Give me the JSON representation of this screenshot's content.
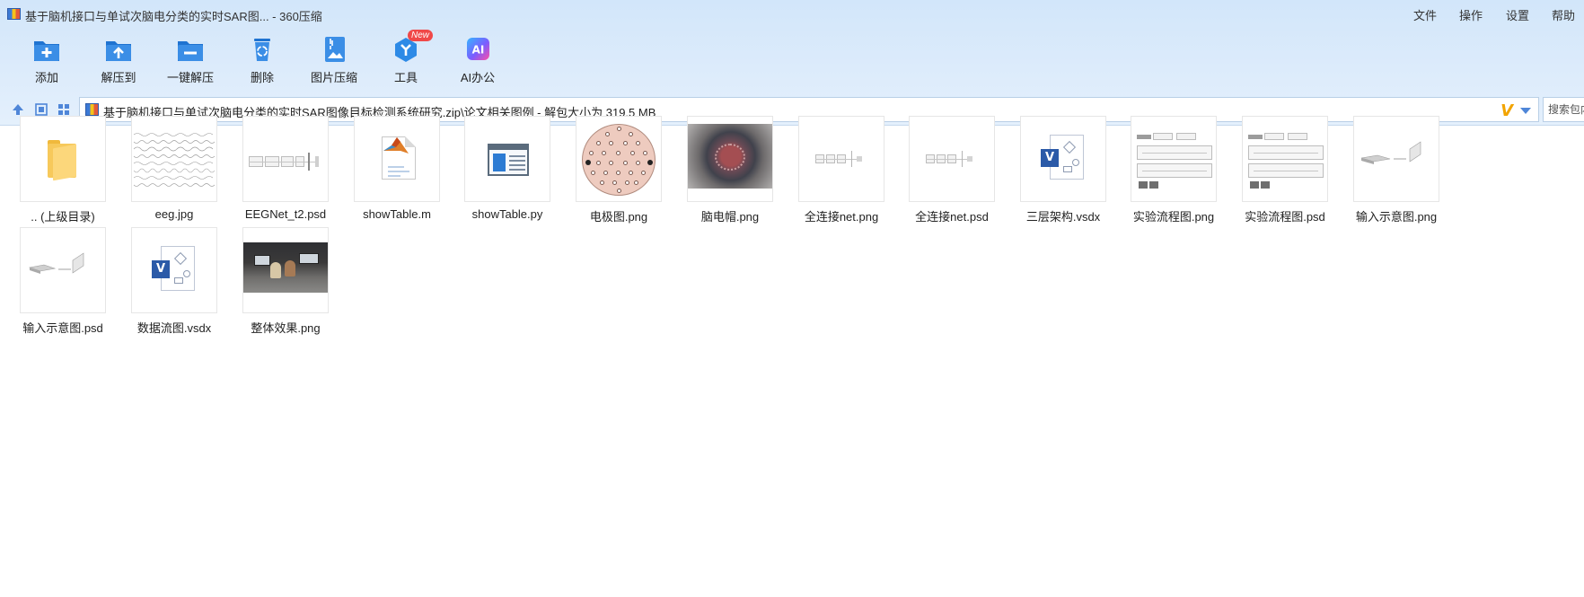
{
  "window": {
    "title": "基于脑机接口与单试次脑电分类的实时SAR图... - 360压缩"
  },
  "menu": {
    "file": "文件",
    "operate": "操作",
    "settings": "设置",
    "help": "帮助"
  },
  "toolbar": {
    "items": [
      {
        "label": "添加",
        "icon": "add-icon"
      },
      {
        "label": "解压到",
        "icon": "extract-to-icon"
      },
      {
        "label": "一键解压",
        "icon": "one-click-extract-icon"
      },
      {
        "label": "删除",
        "icon": "delete-icon"
      },
      {
        "label": "图片压缩",
        "icon": "image-compress-icon"
      },
      {
        "label": "工具",
        "icon": "tools-icon",
        "badge": "New"
      },
      {
        "label": "AI办公",
        "icon": "ai-office-icon",
        "icon_text": "AI"
      }
    ]
  },
  "nav": {
    "path": "基于脑机接口与单试次脑电分类的实时SAR图像目标检测系统研究.zip\\论文相关图例 - 解包大小为 319.5 MB",
    "logo_text": "V",
    "search_placeholder": "搜索包内"
  },
  "colors": {
    "accent": "#2d7fd3",
    "header_bg": "#d8e8fa",
    "badge": "#f04848",
    "folder": "#f7c95b"
  },
  "files": [
    {
      "name": ".. (上级目录)",
      "type": "parent-folder"
    },
    {
      "name": "eeg.jpg",
      "type": "eeg-plot"
    },
    {
      "name": "EEGNet_t2.psd",
      "type": "network-diagram"
    },
    {
      "name": "showTable.m",
      "type": "matlab"
    },
    {
      "name": "showTable.py",
      "type": "python"
    },
    {
      "name": "电极图.png",
      "type": "electrode-map"
    },
    {
      "name": "脑电帽.png",
      "type": "photo-cap"
    },
    {
      "name": "全连接net.png",
      "type": "network-diagram"
    },
    {
      "name": "全连接net.psd",
      "type": "network-diagram"
    },
    {
      "name": "三层架构.vsdx",
      "type": "visio"
    },
    {
      "name": "实验流程图.png",
      "type": "flowchart"
    },
    {
      "name": "实验流程图.psd",
      "type": "flowchart"
    },
    {
      "name": "输入示意图.png",
      "type": "input-diagram"
    },
    {
      "name": "输入示意图.psd",
      "type": "input-diagram"
    },
    {
      "name": "数据流图.vsdx",
      "type": "visio"
    },
    {
      "name": "整体效果.png",
      "type": "photo-room"
    }
  ]
}
